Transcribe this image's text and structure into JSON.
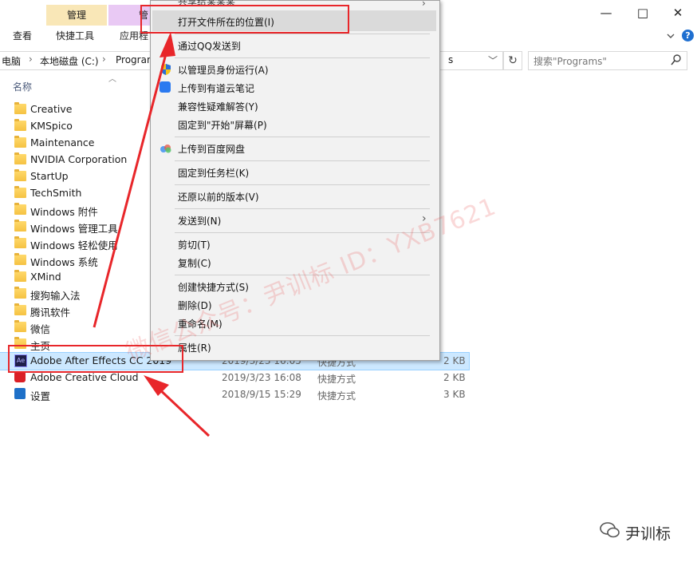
{
  "ribbon": {
    "context_tab_manage": "管理",
    "context_tab_manage2": "管",
    "tabs": [
      "查看",
      "快捷工具",
      "应用程"
    ],
    "window_controls": {
      "minimize": "—",
      "maximize": "□",
      "close": "✕"
    },
    "collapse_icon": "chevron-down-icon",
    "help_icon": "?"
  },
  "address": {
    "crumb_pc": "电脑",
    "crumb_drive": "本地磁盘 (C:)",
    "crumb_programs": "Program",
    "crumb_tail": "s",
    "dropdown": "﹀",
    "refresh": "↻"
  },
  "search": {
    "placeholder": "搜索\"Programs\""
  },
  "list": {
    "header_name": "名称",
    "items": [
      {
        "name": "Creative",
        "kind": "folder"
      },
      {
        "name": "KMSpico",
        "kind": "folder"
      },
      {
        "name": "Maintenance",
        "kind": "folder"
      },
      {
        "name": "NVIDIA Corporation",
        "kind": "folder"
      },
      {
        "name": "StartUp",
        "kind": "folder"
      },
      {
        "name": "TechSmith",
        "kind": "folder"
      },
      {
        "name": "Windows 附件",
        "kind": "folder"
      },
      {
        "name": "Windows 管理工具",
        "kind": "folder"
      },
      {
        "name": "Windows 轻松使用",
        "kind": "folder"
      },
      {
        "name": "Windows 系统",
        "kind": "folder"
      },
      {
        "name": "XMind",
        "kind": "folder"
      },
      {
        "name": "搜狗输入法",
        "kind": "folder"
      },
      {
        "name": "腾讯软件",
        "kind": "folder"
      },
      {
        "name": "微信",
        "kind": "folder"
      },
      {
        "name": "主页",
        "kind": "folder"
      },
      {
        "name": "Adobe After Effects CC 2019",
        "kind": "ae",
        "date": "2019/3/23 16:05",
        "type": "快捷方式",
        "size": "2 KB"
      },
      {
        "name": "Adobe Creative Cloud",
        "kind": "cc",
        "date": "2019/3/23 16:08",
        "type": "快捷方式",
        "size": "2 KB"
      },
      {
        "name": "设置",
        "kind": "settings",
        "date": "2018/9/15 15:29",
        "type": "快捷方式",
        "size": "3 KB"
      }
    ]
  },
  "menu": {
    "top_partial": "共享给某某某",
    "open_location": "打开文件所在的位置(I)",
    "qq_send": "通过QQ发送到",
    "run_admin": "以管理员身份运行(A)",
    "youdao": "上传到有道云笔记",
    "compat": "兼容性疑难解答(Y)",
    "pin_start": "固定到\"开始\"屏幕(P)",
    "baidu": "上传到百度网盘",
    "pin_taskbar": "固定到任务栏(K)",
    "restore": "还原以前的版本(V)",
    "send_to": "发送到(N)",
    "cut": "剪切(T)",
    "copy": "复制(C)",
    "shortcut": "创建快捷方式(S)",
    "delete": "删除(D)",
    "rename": "重命名(M)",
    "properties": "属性(R)"
  },
  "watermark": {
    "text": "微信公众号：尹训标 ID：YXB7621",
    "logo_text": "尹训标"
  },
  "colors": {
    "annotation_red": "#e8262a",
    "selection_blue": "#cce8ff",
    "manage_tab": "#f9e7b7",
    "manage_tab2": "#e9c9f4"
  }
}
